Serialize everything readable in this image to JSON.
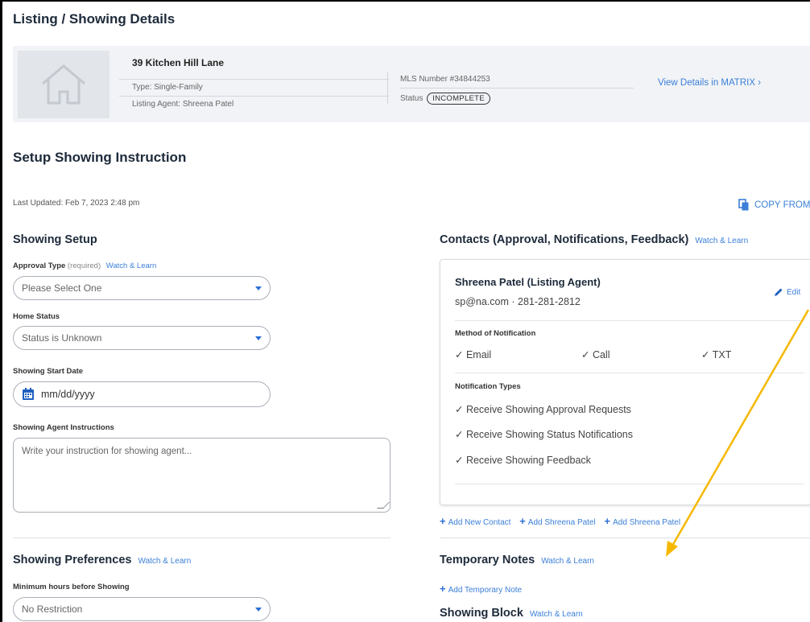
{
  "page": {
    "title": "Listing / Showing Details"
  },
  "listing": {
    "address": "39 Kitchen Hill Lane",
    "type": "Type: Single-Family",
    "listing_agent": "Listing Agent: Shreena Patel",
    "mls": "MLS Number #34844253",
    "status_label": "Status",
    "status_value": "INCOMPLETE",
    "matrix_link": "View Details in MATRIX ›"
  },
  "setup": {
    "title": "Setup Showing Instruction",
    "last_updated": "Last Updated: Feb 7, 2023 2:48 pm",
    "copy_from": "COPY FROM"
  },
  "showing_setup": {
    "title": "Showing Setup",
    "approval_label": "Approval Type",
    "approval_required": "(required)",
    "approval_watch": "Watch & Learn",
    "approval_value": "Please Select One",
    "home_status_label": "Home Status",
    "home_status_value": "Status is Unknown",
    "start_date_label": "Showing Start Date",
    "start_date_placeholder": "mm/dd/yyyy",
    "instructions_label": "Showing Agent Instructions",
    "instructions_placeholder": "Write your instruction for showing agent..."
  },
  "preferences": {
    "title": "Showing Preferences",
    "watch": "Watch & Learn",
    "min_hours_label": "Minimum hours before Showing",
    "min_hours_value": "No Restriction"
  },
  "contacts": {
    "title": "Contacts (Approval, Notifications, Feedback)",
    "watch": "Watch & Learn",
    "card": {
      "name": "Shreena Patel (Listing Agent)",
      "info": "sp@na.com · 281-281-2812",
      "edit": "Edit",
      "method_label": "Method of Notification",
      "methods": [
        "✓ Email",
        "✓ Call",
        "✓ TXT"
      ],
      "types_label": "Notification Types",
      "types": [
        "✓ Receive Showing Approval Requests",
        "✓ Receive Showing Status Notifications",
        "✓ Receive Showing Feedback"
      ]
    },
    "add_links": [
      "Add New Contact",
      "Add Shreena Patel",
      "Add Shreena Patel"
    ]
  },
  "temporary_notes": {
    "title": "Temporary Notes",
    "watch": "Watch & Learn",
    "add": "Add Temporary Note"
  },
  "showing_block": {
    "title": "Showing Block",
    "watch": "Watch & Learn"
  },
  "colors": {
    "accent": "#3b7fd8",
    "arrow": "#f5b800",
    "panel": "#f1f3f6"
  }
}
